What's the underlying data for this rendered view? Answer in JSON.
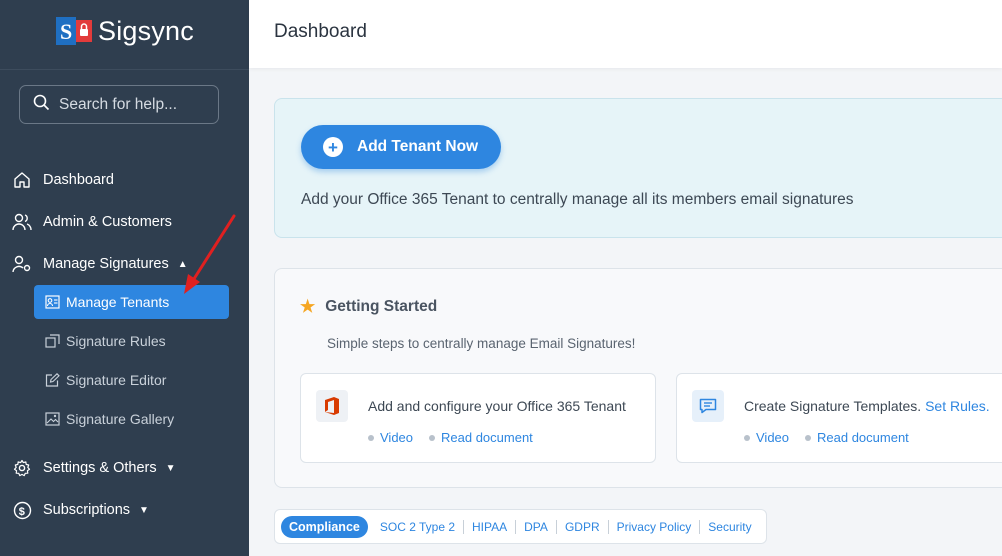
{
  "app": {
    "name": "Sigsync"
  },
  "colors": {
    "sidebar_bg": "#2f3e4f",
    "accent": "#2e86e0",
    "banner_bg": "#e6f4f8",
    "star": "#f5a623",
    "arrow": "#e02020"
  },
  "search": {
    "placeholder": "Search for help..."
  },
  "nav": {
    "dashboard": "Dashboard",
    "admin": "Admin & Customers",
    "manage_signatures": "Manage Signatures",
    "sub": {
      "manage_tenants": "Manage Tenants",
      "signature_rules": "Signature Rules",
      "signature_editor": "Signature Editor",
      "signature_gallery": "Signature Gallery"
    },
    "settings": "Settings & Others",
    "subscriptions": "Subscriptions"
  },
  "header": {
    "title": "Dashboard"
  },
  "banner": {
    "button_label": "Add Tenant Now",
    "description": "Add your Office 365 Tenant to centrally manage all its members email signatures"
  },
  "getting_started": {
    "title": "Getting Started",
    "subtitle": "Simple steps to centrally manage Email Signatures!",
    "steps": [
      {
        "text": "Add and configure your Office 365 Tenant",
        "link_text": "",
        "video": "Video",
        "doc": "Read document",
        "icon": "office-icon"
      },
      {
        "text": "Create Signature Templates. ",
        "link_text": "Set Rules.",
        "video": "Video",
        "doc": "Read document",
        "icon": "template-icon"
      }
    ]
  },
  "compliance": {
    "label": "Compliance",
    "links": [
      "SOC 2 Type 2",
      "HIPAA",
      "DPA",
      "GDPR",
      "Privacy Policy",
      "Security"
    ]
  }
}
